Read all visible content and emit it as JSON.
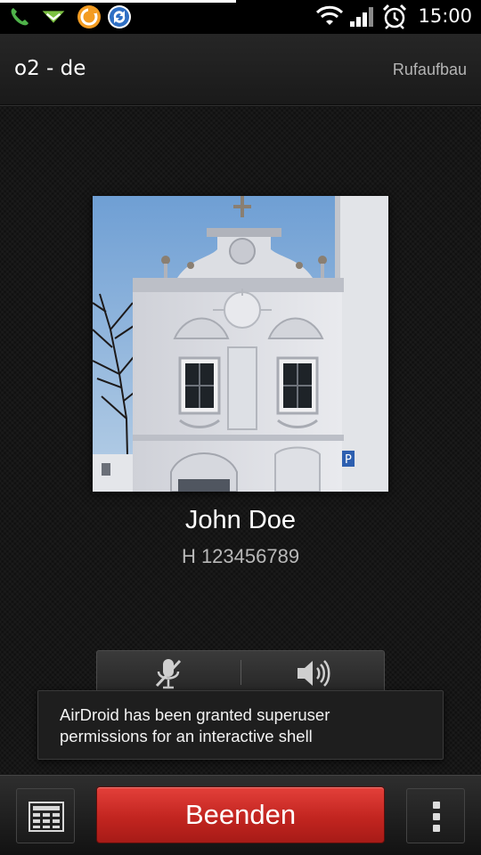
{
  "status_bar": {
    "time": "15:00",
    "notification_icons": [
      "phone-icon",
      "missed-call-icon",
      "app-icon-orange",
      "sync-icon"
    ],
    "system_icons": [
      "wifi-icon",
      "signal-icon",
      "alarm-icon"
    ]
  },
  "header": {
    "carrier": "o2 - de",
    "call_state": "Rufaufbau"
  },
  "contact": {
    "name": "John Doe",
    "number": "H 123456789"
  },
  "call_controls": {
    "mute_icon": "mute-microphone-icon",
    "speaker_icon": "speaker-icon"
  },
  "toast": {
    "line1": "AirDroid has been granted superuser",
    "line2": "permissions for an interactive shell"
  },
  "bottom_bar": {
    "end_call_label": "Beenden",
    "keypad_icon": "dialpad-icon",
    "menu_icon": "overflow-menu-icon"
  },
  "colors": {
    "end_call": "#c22520",
    "background": "#161616",
    "secondary_text": "#b8b8b8"
  }
}
